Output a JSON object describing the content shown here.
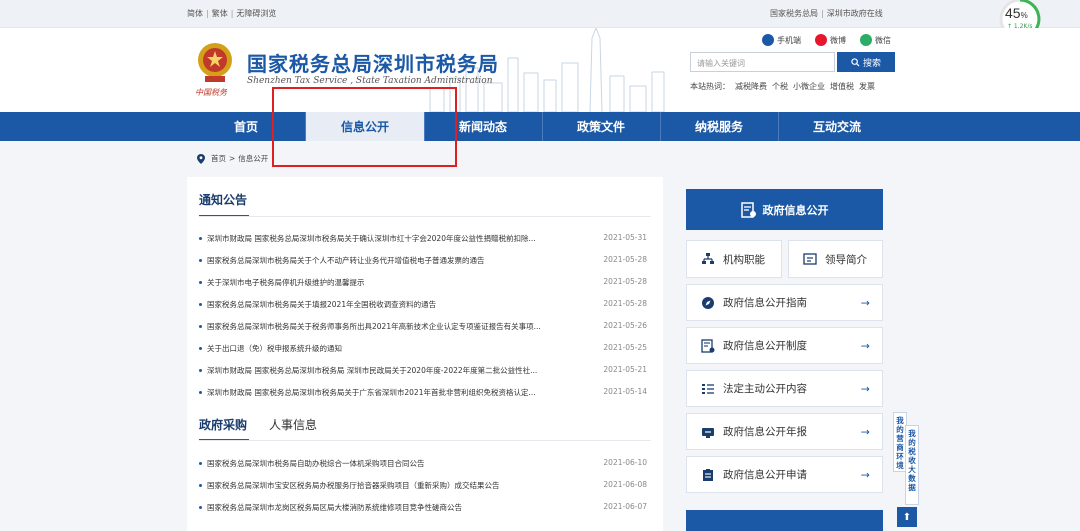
{
  "topbar": {
    "simplified": "简体",
    "traditional": "繁体",
    "accessible": "无障碍浏览",
    "sta_link": "国家税务总局",
    "sz_gov_link": "深圳市政府在线"
  },
  "header": {
    "title": "国家税务总局深圳市税务局",
    "subtitle": "Shenzhen Tax Service , State Taxation Administration",
    "china_tax": "中国税务",
    "social": {
      "mobile": "手机端",
      "weibo": "微博",
      "wechat": "微信"
    },
    "search_placeholder": "请输入关键词",
    "search_button": "搜索",
    "hot_label": "本站热词：",
    "hot_words": [
      "减税降费",
      "个税",
      "小微企业",
      "增值税",
      "发票"
    ]
  },
  "speed": {
    "percent": "45",
    "percent_unit": "%",
    "rate": "↑ 1.2K/s"
  },
  "nav": [
    "首页",
    "信息公开",
    "新闻动态",
    "政策文件",
    "纳税服务",
    "互动交流"
  ],
  "nav_active": "信息公开",
  "breadcrumb": {
    "home": "首页",
    "sep": ">",
    "current": "信息公开"
  },
  "notice": {
    "title": "通知公告",
    "items": [
      {
        "title": "深圳市财政局 国家税务总局深圳市税务局关于确认深圳市红十字会2020年度公益性捐赠税前扣除...",
        "date": "2021-05-31"
      },
      {
        "title": "国家税务总局深圳市税务局关于个人不动产转让业务代开增值税电子普通发票的通告",
        "date": "2021-05-28"
      },
      {
        "title": "关于深圳市电子税务局停机升级维护的温馨提示",
        "date": "2021-05-28"
      },
      {
        "title": "国家税务总局深圳市税务局关于填报2021年全国税收调查资料的通告",
        "date": "2021-05-28"
      },
      {
        "title": "国家税务总局深圳市税务局关于税务师事务所出具2021年高新技术企业认定专项鉴证报告有关事项...",
        "date": "2021-05-26"
      },
      {
        "title": "关于出口退（免）税申报系统升级的通知",
        "date": "2021-05-25"
      },
      {
        "title": "深圳市财政局 国家税务总局深圳市税务局 深圳市民政局关于2020年度-2022年度第二批公益性社...",
        "date": "2021-05-21"
      },
      {
        "title": "深圳市财政局 国家税务总局深圳市税务局关于广东省深圳市2021年首批非营利组织免税资格认定...",
        "date": "2021-05-14"
      }
    ]
  },
  "procurement": {
    "title": "政府采购",
    "tab2": "人事信息",
    "items": [
      {
        "title": "国家税务总局深圳市税务局自助办税综合一体机采购项目合同公告",
        "date": "2021-06-10"
      },
      {
        "title": "国家税务总局深圳市宝安区税务局办税服务厅拾音器采购项目（重新采购）成交结果公告",
        "date": "2021-06-08"
      },
      {
        "title": "国家税务总局深圳市龙岗区税务局区局大楼消防系统维修项目竞争性磋商公告",
        "date": "2021-06-07"
      }
    ]
  },
  "sidebar": {
    "gov_open": "政府信息公开",
    "org_functions": "机构职能",
    "leader_intro": "领导简介",
    "buttons": [
      {
        "label": "政府信息公开指南",
        "arrow": "→"
      },
      {
        "label": "政府信息公开制度",
        "arrow": "→"
      },
      {
        "label": "法定主动公开内容",
        "arrow": "→"
      },
      {
        "label": "政府信息公开年报",
        "arrow": "→"
      },
      {
        "label": "政府信息公开申请",
        "arrow": "→"
      }
    ]
  },
  "float_tabs": {
    "left": "我的营商环境",
    "right": "我的税收大数据"
  },
  "back_top": "⬆",
  "colors": {
    "brand": "#1b58a5",
    "highlight_box": "#e02020",
    "nav_active_bg": "#e8edf5"
  }
}
